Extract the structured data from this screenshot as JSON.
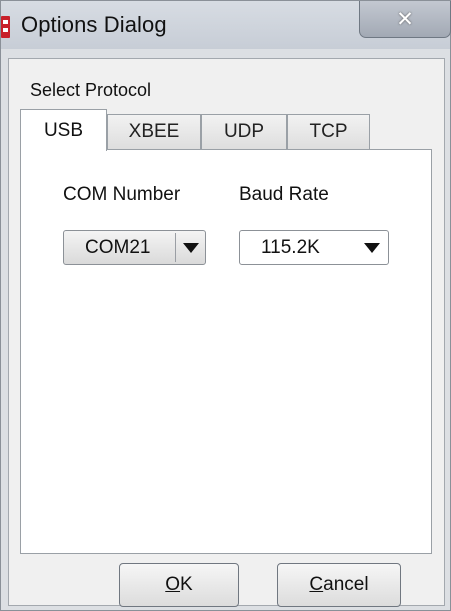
{
  "window": {
    "title": "Options Dialog",
    "close_glyph": "✕"
  },
  "group": {
    "label": "Select Protocol"
  },
  "tabs": [
    {
      "label": "USB",
      "active": true
    },
    {
      "label": "XBEE",
      "active": false
    },
    {
      "label": "UDP",
      "active": false
    },
    {
      "label": "TCP",
      "active": false
    }
  ],
  "usb": {
    "com_number": {
      "label": "COM Number",
      "value": "COM21"
    },
    "baud_rate": {
      "label": "Baud Rate",
      "value": "115.2K"
    }
  },
  "buttons": {
    "ok": "OK",
    "cancel": "Cancel"
  },
  "icons": {
    "app": "app-icon",
    "close": "close-icon",
    "dropdown": "dropdown-arrow-icon"
  },
  "colors": {
    "title_bar": "#c7cdd6",
    "dialog_background": "#f0f0f0",
    "app_icon": "#c8202a"
  }
}
